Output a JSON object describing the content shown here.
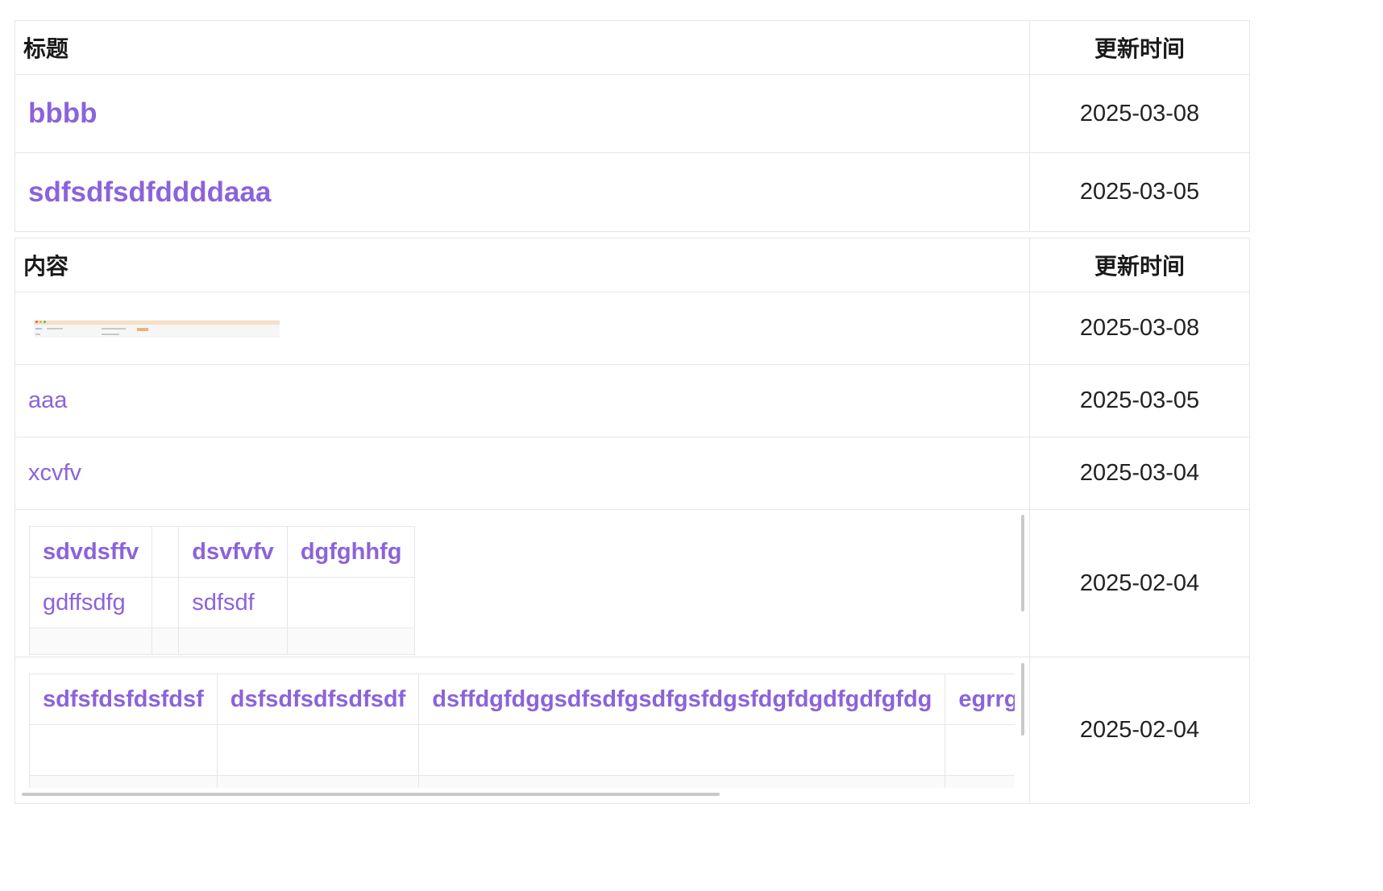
{
  "titles_table": {
    "header": {
      "title_col": "标题",
      "time_col": "更新时间"
    },
    "rows": [
      {
        "title": "bbbb",
        "updated": "2025-03-08"
      },
      {
        "title": "sdfsdfsdfddddaaa",
        "updated": "2025-03-05"
      }
    ]
  },
  "contents_table": {
    "header": {
      "content_col": "内容",
      "time_col": "更新时间"
    },
    "rows": [
      {
        "type": "image",
        "updated": "2025-03-08"
      },
      {
        "type": "text",
        "content": "aaa",
        "updated": "2025-03-05"
      },
      {
        "type": "text",
        "content": "xcvfv",
        "updated": "2025-03-04"
      },
      {
        "type": "table",
        "updated": "2025-02-04",
        "table": {
          "row1": [
            "sdvdsffv",
            "",
            "dsvfvfv",
            "dgfghhfg"
          ],
          "row2": [
            "gdffsdfg",
            "",
            "sdfsdf",
            ""
          ]
        }
      },
      {
        "type": "table",
        "updated": "2025-02-04",
        "table": {
          "row1": [
            "sdfsfdsfdsfdsf",
            "dsfsdfsdfsdfsdf",
            "dsffdgfdggsdfsdfgsdfgsfdgsfdgfdgdfgdfgfdg",
            "egrrgl"
          ]
        }
      }
    ]
  },
  "colors": {
    "link": "#8b63db",
    "border": "#e6e6e6",
    "text": "#222222"
  }
}
